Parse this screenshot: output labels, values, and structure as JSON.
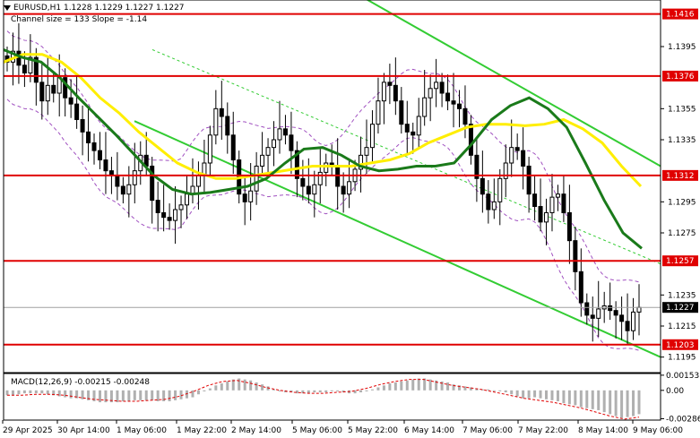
{
  "header": {
    "symbol_line": "EURUSD,H1  1.1228 1.1229 1.1227 1.1227",
    "channel_line": "Channel size = 133 Slope = -1.14"
  },
  "macd_label": "MACD(12,26,9) -0.00215 -0.00248",
  "colors": {
    "candle": "#000000",
    "level_line": "#e00000",
    "level_label_bg": "#e00000",
    "ma_fast": "#1a7a1a",
    "ma_slow": "#ffee00",
    "channel": "#33cc33",
    "channel_mid": "#33cc33",
    "envelope": "#a050c0",
    "histogram": "#b0b0b0",
    "signal": "#e00000",
    "price_label_bg": "#000000"
  },
  "chart_data": {
    "type": "candlestick",
    "symbol": "EURUSD",
    "timeframe": "H1",
    "ylim": [
      1.1185,
      1.1425
    ],
    "y_ticks": [
      1.1395,
      1.1355,
      1.1335,
      1.1295,
      1.1275,
      1.1235,
      1.1215,
      1.1195
    ],
    "x_ticks": [
      "29 Apr 2025",
      "30 Apr 14:00",
      "1 May 06:00",
      "1 May 22:00",
      "2 May 14:00",
      "5 May 06:00",
      "5 May 22:00",
      "6 May 14:00",
      "7 May 06:00",
      "7 May 22:00",
      "8 May 14:00",
      "9 May 06:00"
    ],
    "levels": [
      {
        "label": "1.1416",
        "value": 1.1416
      },
      {
        "label": "1.1376",
        "value": 1.1376
      },
      {
        "label": "1.1312",
        "value": 1.1312
      },
      {
        "label": "1.1257",
        "value": 1.1257
      },
      {
        "label": "1.1203",
        "value": 1.1203
      }
    ],
    "current_price": {
      "label": "1.1227",
      "value": 1.1227
    },
    "close_path": [
      1.1385,
      1.1392,
      1.1383,
      1.1378,
      1.1388,
      1.1372,
      1.136,
      1.137,
      1.1365,
      1.1375,
      1.1362,
      1.1358,
      1.1348,
      1.134,
      1.1333,
      1.1328,
      1.1322,
      1.1315,
      1.1312,
      1.1305,
      1.13,
      1.1306,
      1.1315,
      1.1325,
      1.1318,
      1.1296,
      1.1288,
      1.1285,
      1.1283,
      1.129,
      1.1293,
      1.13,
      1.1305,
      1.1312,
      1.132,
      1.1338,
      1.1355,
      1.135,
      1.1338,
      1.1322,
      1.13,
      1.1295,
      1.1302,
      1.1318,
      1.1325,
      1.133,
      1.1335,
      1.1342,
      1.1338,
      1.1328,
      1.131,
      1.1305,
      1.13,
      1.1306,
      1.1314,
      1.132,
      1.1318,
      1.1305,
      1.13,
      1.1308,
      1.1316,
      1.1325,
      1.133,
      1.1345,
      1.136,
      1.1372,
      1.137,
      1.136,
      1.1345,
      1.134,
      1.1338,
      1.135,
      1.1362,
      1.1368,
      1.1372,
      1.1365,
      1.136,
      1.1358,
      1.1355,
      1.1345,
      1.1325,
      1.131,
      1.13,
      1.129,
      1.1295,
      1.131,
      1.132,
      1.133,
      1.1328,
      1.1318,
      1.13,
      1.1292,
      1.1282,
      1.1288,
      1.1298,
      1.13,
      1.1288,
      1.127,
      1.125,
      1.123,
      1.1222,
      1.122,
      1.1226,
      1.1228,
      1.1225,
      1.1222,
      1.1218,
      1.1212,
      1.1224,
      1.1227
    ],
    "ma_fast": [
      1.1393,
      1.1388,
      1.1385,
      1.1375,
      1.1362,
      1.135,
      1.1338,
      1.1325,
      1.1312,
      1.1303,
      1.13,
      1.1301,
      1.1303,
      1.1305,
      1.131,
      1.132,
      1.1329,
      1.133,
      1.1325,
      1.1318,
      1.1315,
      1.1316,
      1.1318,
      1.1318,
      1.132,
      1.1333,
      1.1348,
      1.1357,
      1.1362,
      1.1355,
      1.1343,
      1.132,
      1.1296,
      1.1275,
      1.1265
    ],
    "ma_slow": [
      1.1385,
      1.139,
      1.139,
      1.1385,
      1.1375,
      1.1362,
      1.1352,
      1.134,
      1.133,
      1.132,
      1.1314,
      1.131,
      1.131,
      1.1312,
      1.1314,
      1.1316,
      1.1318,
      1.1318,
      1.1318,
      1.132,
      1.1322,
      1.1326,
      1.1333,
      1.1338,
      1.1343,
      1.1345,
      1.1345,
      1.1344,
      1.1345,
      1.1348,
      1.1342,
      1.1333,
      1.1318,
      1.1305
    ],
    "channel": {
      "upper": [
        [
          1.143,
          1.1318
        ]
      ],
      "lower": [
        [
          1.1347,
          1.1195
        ]
      ],
      "mid": [
        [
          1.1365,
          1.1255
        ]
      ]
    },
    "macd": {
      "label": "MACD(12,26,9) -0.00215 -0.00248",
      "ylim": [
        -0.003,
        0.0017
      ],
      "y_ticks": [
        {
          "label": "0.00153",
          "value": 0.00153
        },
        {
          "label": "0.00",
          "value": 0.0
        },
        {
          "label": "-0.00286",
          "value": -0.00286
        }
      ],
      "histogram": [
        -0.0005,
        -0.0005,
        -0.0004,
        -0.0003,
        -0.0003,
        -0.0003,
        -0.0003,
        -0.0004,
        -0.0005,
        -0.0006,
        -0.0007,
        -0.0008,
        -0.0008,
        -0.0009,
        -0.001,
        -0.0011,
        -0.0012,
        -0.0012,
        -0.0012,
        -0.0012,
        -0.0011,
        -0.0011,
        -0.001,
        -0.001,
        -0.001,
        -0.001,
        -0.0011,
        -0.0011,
        -0.0011,
        -0.001,
        -0.0009,
        -0.0008,
        -0.0007,
        -0.0004,
        -0.0001,
        0.0002,
        0.0005,
        0.0007,
        0.0009,
        0.0011,
        0.0012,
        0.0011,
        0.001,
        0.0008,
        0.0006,
        0.0004,
        0.0001,
        -0.0001,
        -0.0002,
        -0.0002,
        -0.0003,
        -0.0003,
        -0.0003,
        -0.0002,
        -0.0002,
        -0.0002,
        -0.0001,
        -0.0001,
        -0.0002,
        -0.0003,
        -0.0003,
        -0.0002,
        -0.0001,
        0.0001,
        0.0003,
        0.0005,
        0.0007,
        0.0008,
        0.0009,
        0.001,
        0.0011,
        0.0012,
        0.0012,
        0.0011,
        0.001,
        0.0009,
        0.0008,
        0.0006,
        0.0005,
        0.0004,
        0.0003,
        0.0002,
        0.0001,
        0.0001,
        0.0,
        -0.0001,
        -0.0002,
        -0.0004,
        -0.0006,
        -0.0008,
        -0.0008,
        -0.0007,
        -0.0008,
        -0.0009,
        -0.001,
        -0.0011,
        -0.0013,
        -0.0014,
        -0.0015,
        -0.0017,
        -0.0018,
        -0.0019,
        -0.002,
        -0.0022,
        -0.0024,
        -0.0026,
        -0.0028,
        -0.0027,
        -0.0026,
        -0.0024
      ],
      "signal": [
        -0.0005,
        -0.0005,
        -0.0004,
        -0.0004,
        -0.0005,
        -0.0007,
        -0.0009,
        -0.001,
        -0.0011,
        -0.0011,
        -0.001,
        -0.0009,
        -0.0006,
        -0.0001,
        0.0005,
        0.0009,
        0.001,
        0.0007,
        0.0003,
        0.0,
        -0.0002,
        -0.0003,
        -0.0003,
        -0.0002,
        -0.0001,
        0.0002,
        0.0006,
        0.0009,
        0.0011,
        0.0011,
        0.0008,
        0.0005,
        0.0003,
        0.0001,
        -0.0002,
        -0.0005,
        -0.0008,
        -0.001,
        -0.0012,
        -0.0015,
        -0.0018,
        -0.0022,
        -0.0026,
        -0.0029,
        -0.0027
      ]
    }
  }
}
